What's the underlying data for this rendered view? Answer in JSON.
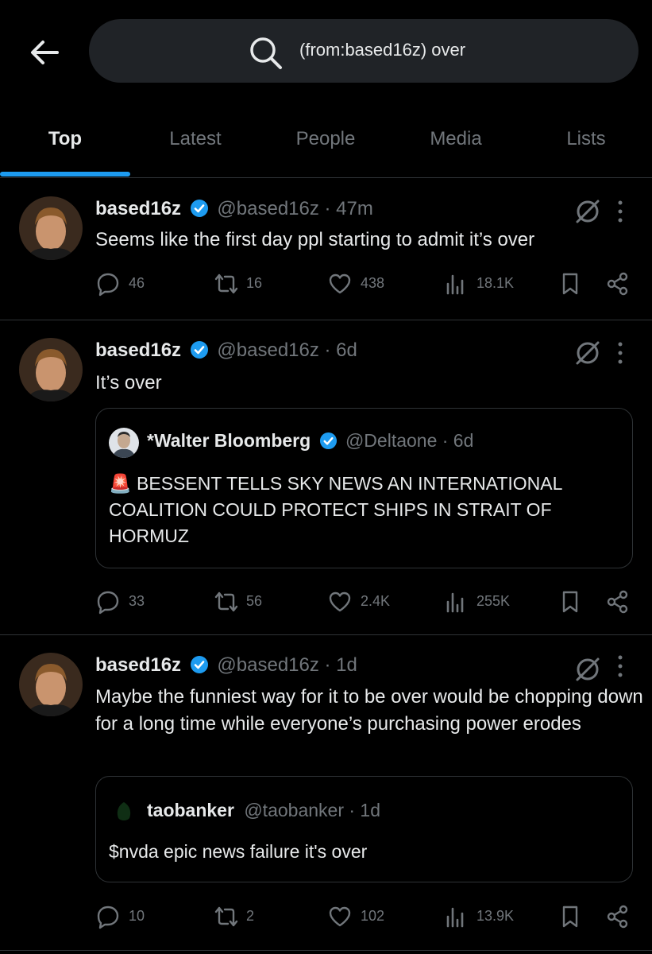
{
  "search": {
    "query": "(from:based16z) over"
  },
  "tabs": [
    {
      "label": "Top",
      "active": true
    },
    {
      "label": "Latest",
      "active": false
    },
    {
      "label": "People",
      "active": false
    },
    {
      "label": "Media",
      "active": false
    },
    {
      "label": "Lists",
      "active": false
    }
  ],
  "colors": {
    "accent": "#1d9bf0",
    "background": "#000000",
    "muted": "#71767b",
    "text": "#e7e9ea"
  },
  "posts": [
    {
      "author": "based16z",
      "meta": "@based16z · 47m",
      "text": "Seems like the first day ppl starting to admit it’s over",
      "replies": "46",
      "reposts": "16",
      "likes": "438",
      "views": "18.1K"
    },
    {
      "author": "based16z",
      "meta": "@based16z · 6d",
      "text": "It’s over",
      "quote": {
        "author": "*Walter Bloomberg",
        "meta": "@Deltaone · 6d",
        "text": "🚨 BESSENT TELLS SKY NEWS AN INTERNATIONAL COALITION COULD PROTECT SHIPS IN STRAIT OF HORMUZ"
      },
      "replies": "33",
      "reposts": "56",
      "likes": "2.4K",
      "views": "255K"
    },
    {
      "author": "based16z",
      "meta": "@based16z · 1d",
      "text": "Maybe the funniest way for it to be over would be chopping down for a long time while everyone’s purchasing power erodes",
      "quote": {
        "author": "taobanker",
        "meta": "@taobanker · 1d",
        "text": "$nvda epic news failure it's over"
      },
      "replies": "10",
      "reposts": "2",
      "likes": "102",
      "views": "13.9K"
    }
  ],
  "icons": [
    "back-arrow-icon",
    "search-icon",
    "verified-badge-icon",
    "grok-icon",
    "more-icon",
    "reply-icon",
    "repost-icon",
    "like-icon",
    "views-icon",
    "bookmark-icon",
    "share-icon"
  ]
}
